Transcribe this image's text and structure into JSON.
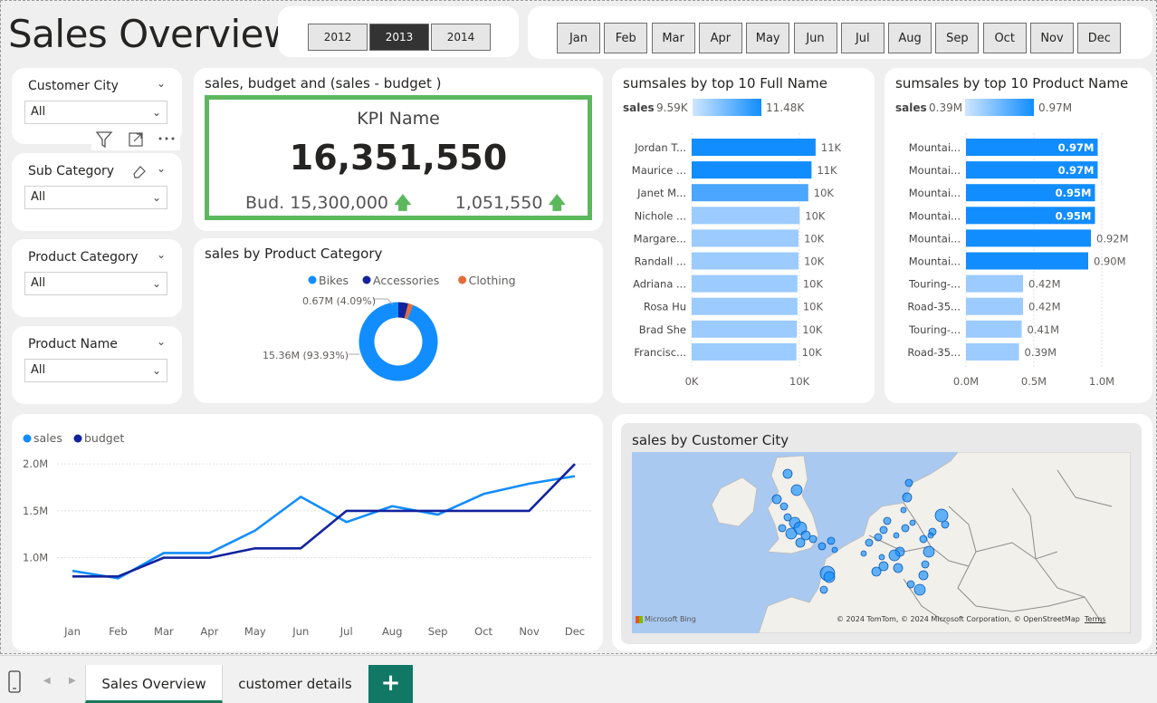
{
  "page_title": "Sales Overview",
  "years": [
    {
      "label": "2012",
      "selected": false
    },
    {
      "label": "2013",
      "selected": true
    },
    {
      "label": "2014",
      "selected": false
    }
  ],
  "months": [
    "Jan",
    "Feb",
    "Mar",
    "Apr",
    "May",
    "Jun",
    "Jul",
    "Aug",
    "Sep",
    "Oct",
    "Nov",
    "Dec"
  ],
  "slicers": [
    {
      "title": "Customer City",
      "value": "All"
    },
    {
      "title": "Sub Category",
      "value": "All"
    },
    {
      "title": "Product Category",
      "value": "All"
    },
    {
      "title": "Product Name",
      "value": "All"
    }
  ],
  "kpi": {
    "title": "sales, budget and (sales - budget )",
    "name": "KPI Name",
    "value": "16,351,550",
    "budget_label": "Bud. 15,300,000",
    "variance_label": "1,051,550",
    "accent": "#5cb85c"
  },
  "donut": {
    "title": "sales by Product Category",
    "label_small": "0.67M (4.09%)",
    "label_large": "15.36M (93.93%)"
  },
  "top_names": {
    "title": "sumsales by top 10 Full Name",
    "legend_field": "sales",
    "legend_min": "9.59K",
    "legend_max": "11.48K"
  },
  "top_products": {
    "title": "sumsales by top 10 Product Name",
    "legend_field": "sales",
    "legend_min": "0.39M",
    "legend_max": "0.97M"
  },
  "line": {
    "title": ""
  },
  "map": {
    "title": "sales by Customer City",
    "provider": "Microsoft Bing",
    "attribution": "© 2024 TomTom, © 2024 Microsoft Corporation, © OpenStreetMap",
    "terms": "Terms"
  },
  "tabs": [
    "Sales Overview",
    "customer details"
  ],
  "add_tab": "+",
  "chart_data": [
    {
      "type": "pie",
      "title": "sales by Product Category",
      "categories": [
        "Bikes",
        "Accessories",
        "Clothing"
      ],
      "values": [
        93.93,
        4.09,
        1.98
      ],
      "colors": [
        "#118dff",
        "#12239e",
        "#e66c37"
      ],
      "legend": "top"
    },
    {
      "type": "bar",
      "orientation": "horizontal",
      "title": "sumsales by top 10 Full Name",
      "categories": [
        "Jordan T...",
        "Maurice ...",
        "Janet M...",
        "Nichole ...",
        "Margare...",
        "Randall ...",
        "Adriana ...",
        "Rosa Hu",
        "Brad She",
        "Francisc..."
      ],
      "values": [
        11.48,
        11.1,
        10.8,
        10.0,
        9.9,
        9.9,
        9.8,
        9.8,
        9.75,
        9.7
      ],
      "labels": [
        "11K",
        "11K",
        "10K",
        "10K",
        "10K",
        "10K",
        "10K",
        "10K",
        "10K",
        "10K"
      ],
      "xticks": [
        "0K",
        "10K"
      ],
      "xlim": [
        0,
        13.5
      ]
    },
    {
      "type": "bar",
      "orientation": "horizontal",
      "title": "sumsales by top 10 Product Name",
      "categories": [
        "Mountai...",
        "Mountai...",
        "Mountai...",
        "Mountai...",
        "Mountai...",
        "Mountai...",
        "Touring-...",
        "Road-35...",
        "Touring-...",
        "Road-35..."
      ],
      "values": [
        0.97,
        0.97,
        0.95,
        0.95,
        0.92,
        0.9,
        0.42,
        0.42,
        0.41,
        0.39
      ],
      "labels": [
        "0.97M",
        "0.97M",
        "0.95M",
        "0.95M",
        "0.92M",
        "0.90M",
        "0.42M",
        "0.42M",
        "0.41M",
        "0.39M"
      ],
      "xticks": [
        "0.0M",
        "0.5M",
        "1.0M"
      ],
      "xlim": [
        0,
        1.0
      ]
    },
    {
      "type": "line",
      "title": "",
      "categories": [
        "Jan",
        "Feb",
        "Mar",
        "Apr",
        "May",
        "Jun",
        "Jul",
        "Aug",
        "Sep",
        "Oct",
        "Nov",
        "Dec"
      ],
      "series": [
        {
          "name": "sales",
          "color": "#118dff",
          "values": [
            0.86,
            0.78,
            1.05,
            1.05,
            1.29,
            1.65,
            1.38,
            1.55,
            1.46,
            1.68,
            1.79,
            1.87
          ]
        },
        {
          "name": "budget",
          "color": "#12239e",
          "values": [
            0.8,
            0.8,
            1.0,
            1.0,
            1.1,
            1.1,
            1.5,
            1.5,
            1.5,
            1.5,
            1.5,
            2.0
          ]
        }
      ],
      "yticks": [
        "1.0M",
        "1.5M",
        "2.0M"
      ],
      "ylim": [
        0.6,
        2.05
      ],
      "legend": "top-left"
    }
  ]
}
